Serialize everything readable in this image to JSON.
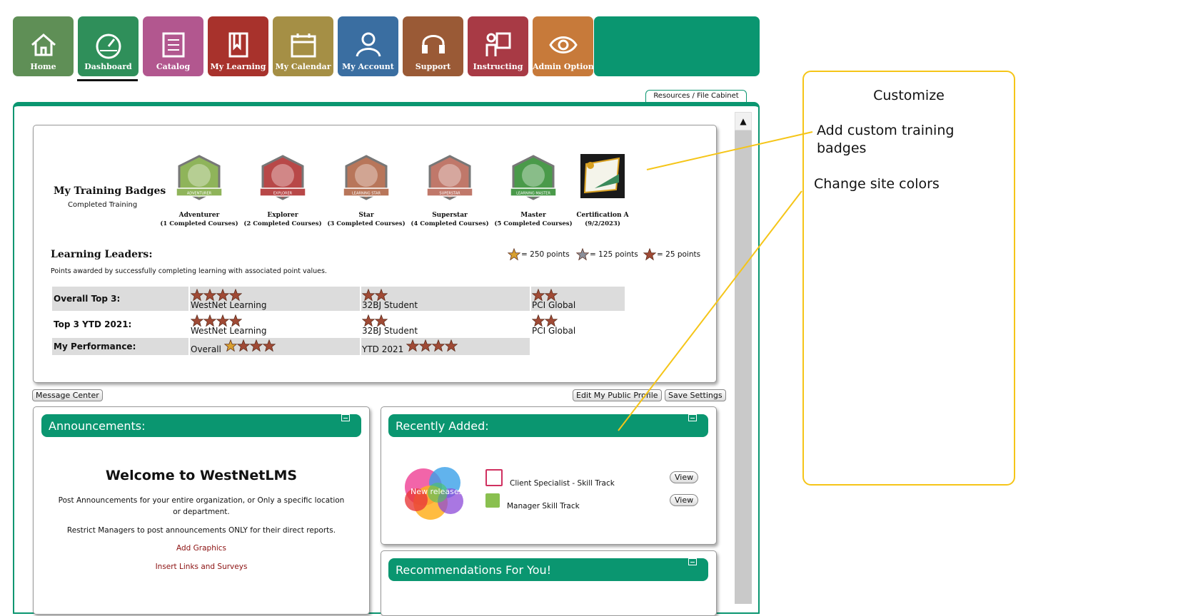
{
  "nav": {
    "tiles": [
      {
        "label": "Home",
        "icon": "home-icon",
        "color": "#5f8f56"
      },
      {
        "label": "Dashboard",
        "icon": "speedometer-icon",
        "color": "#2f8f5a"
      },
      {
        "label": "Catalog",
        "icon": "list-icon",
        "color": "#b2578f"
      },
      {
        "label": "My Learning",
        "icon": "book-icon",
        "color": "#a8322c"
      },
      {
        "label": "My Calendar",
        "icon": "calendar-icon",
        "color": "#a58f45"
      },
      {
        "label": "My Account",
        "icon": "user-icon",
        "color": "#3a6ea1"
      },
      {
        "label": "Support",
        "icon": "headset-icon",
        "color": "#9a5a36"
      },
      {
        "label": "Instructing",
        "icon": "presenter-icon",
        "color": "#a83a45"
      },
      {
        "label": "Admin Options",
        "icon": "eye-icon",
        "color": "#c77a3a"
      }
    ]
  },
  "resources_tab": "Resources / File Cabinet",
  "badges": {
    "title": "My Training Badges",
    "subtitle": "Completed Training",
    "items": [
      {
        "name": "Adventurer",
        "desc": "(1 Completed Courses)",
        "ribbon": "ADVENTURER",
        "color": "#8fb45a",
        "icon": "book-icon"
      },
      {
        "name": "Explorer",
        "desc": "(2 Completed Courses)",
        "ribbon": "EXPLORER",
        "color": "#b84848",
        "icon": "sailboat-icon"
      },
      {
        "name": "Star",
        "desc": "(3 Completed Courses)",
        "ribbon": "LEARNING STAR",
        "color": "#b8765a",
        "icon": "star-icon"
      },
      {
        "name": "Superstar",
        "desc": "(4 Completed Courses)",
        "ribbon": "SUPERSTAR",
        "color": "#c0786a",
        "icon": "atom-icon"
      },
      {
        "name": "Master",
        "desc": "(5 Completed Courses)",
        "ribbon": "LEARNING MASTER",
        "color": "#4a9a4a",
        "icon": "trophy-icon"
      },
      {
        "name": "Certification A",
        "desc": "(9/2/2023)",
        "ribbon": "",
        "color": "#222",
        "icon": "certificate-icon"
      }
    ]
  },
  "leaders": {
    "title": "Learning Leaders:",
    "desc": "Points awarded by successfully completing learning with associated point values.",
    "legend": [
      {
        "text": "= 250 points",
        "color": "#d8a030"
      },
      {
        "text": "= 125 points",
        "color": "#8a8f9a"
      },
      {
        "text": "= 25 points",
        "color": "#a04a35"
      }
    ],
    "rows": [
      {
        "label": "Overall Top 3:",
        "cells": [
          {
            "stars": 4,
            "name": "WestNet Learning"
          },
          {
            "stars": 2,
            "name": "32BJ Student"
          },
          {
            "stars": 2,
            "name": "PCI Global"
          }
        ]
      },
      {
        "label": "Top 3 YTD 2021:",
        "cells": [
          {
            "stars": 4,
            "name": "WestNet Learning"
          },
          {
            "stars": 2,
            "name": "32BJ Student"
          },
          {
            "stars": 2,
            "name": "PCI Global"
          }
        ]
      },
      {
        "label": "My Performance:",
        "overall": "Overall",
        "ytd": "YTD 2021"
      }
    ]
  },
  "buttons": {
    "message_center": "Message Center",
    "edit_profile": "Edit My Public Profile",
    "save_settings": "Save Settings"
  },
  "announcements": {
    "header": "Announcements:",
    "title": "Welcome to WestNetLMS",
    "p1": "Post Announcements for your entire organization, or Only a specific location or department.",
    "p2": "Restrict Managers to post announcements ONLY for their direct reports.",
    "link1": "Add Graphics",
    "link2": "Insert Links and Surveys"
  },
  "recent": {
    "header": "Recently Added:",
    "image_text": "New releases",
    "courses": [
      {
        "name": "Client Specialist - Skill Track",
        "view": "View"
      },
      {
        "name": "Manager Skill Track",
        "view": "View"
      }
    ]
  },
  "recommend": {
    "header": "Recommendations For You!"
  },
  "callout": {
    "title": "Customize",
    "item1": "Add custom training badges",
    "item2": "Change site colors"
  },
  "colors": {
    "accent": "#0a9670",
    "callout": "#f5c518"
  }
}
